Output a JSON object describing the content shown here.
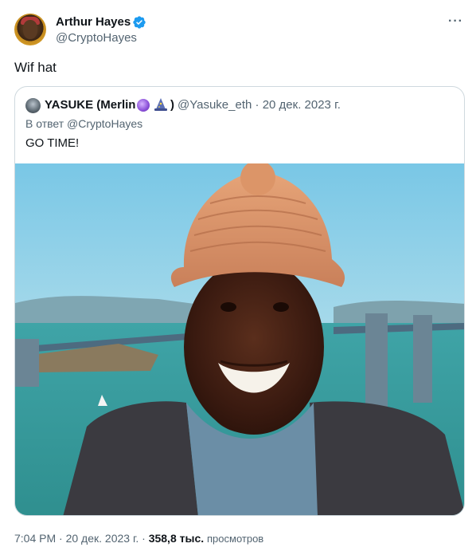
{
  "author": {
    "name": "Arthur Hayes",
    "handle": "@CryptoHayes",
    "verified": true
  },
  "menu_icon": "more-horizontal-icon",
  "tweet_text": "Wif hat",
  "quote": {
    "name": "YASUKE (Merlin",
    "emojis": [
      "purple-orb-icon",
      "wizard-icon"
    ],
    "close_paren": ")",
    "handle": "@Yasuke_eth",
    "separator": " · ",
    "date": "20 дек. 2023 г.",
    "reply_to": "В ответ @CryptoHayes",
    "text": "GO TIME!",
    "media": "photo-smiling-man-in-knit-hat-bay-bridge-background"
  },
  "footer": {
    "time": "7:04 PM",
    "separator": " · ",
    "date": "20 дек. 2023 г.",
    "views_count": "358,8 тыс.",
    "views_label": "просмотров"
  },
  "colors": {
    "text_primary": "#0f1419",
    "text_secondary": "#536471",
    "border": "#cfd9de",
    "verified_blue": "#1d9bf0"
  }
}
